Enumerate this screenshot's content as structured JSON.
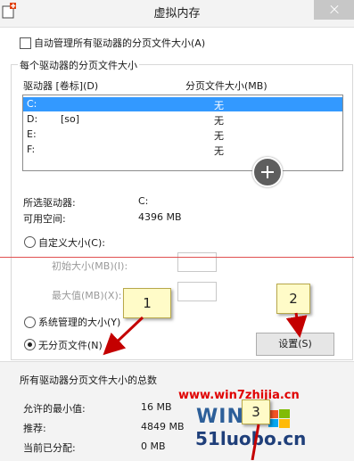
{
  "window": {
    "title": "虚拟内存"
  },
  "auto_manage": {
    "label": "自动管理所有驱动器的分页文件大小(A)"
  },
  "per_drive": {
    "group_title": "每个驱动器的分页文件大小",
    "col_drive": "驱动器 [卷标](D)",
    "col_size": "分页文件大小(MB)",
    "rows": [
      {
        "drive": "C:",
        "label": "",
        "size": "无"
      },
      {
        "drive": "D:",
        "label": "[so]",
        "size": "无"
      },
      {
        "drive": "E:",
        "label": "",
        "size": "无"
      },
      {
        "drive": "F:",
        "label": "",
        "size": "无"
      }
    ]
  },
  "selected_drive": {
    "label": "所选驱动器:",
    "value": "C:"
  },
  "free_space": {
    "label": "可用空间:",
    "value": "4396 MB"
  },
  "custom_size": {
    "label": "自定义大小(C):"
  },
  "initial_size": {
    "label": "初始大小(MB)(I):"
  },
  "max_size": {
    "label": "最大值(MB)(X):"
  },
  "system_managed": {
    "label": "系统管理的大小(Y)"
  },
  "no_paging": {
    "label": "无分页文件(N)"
  },
  "set_button": {
    "label": "设置(S)"
  },
  "callouts": {
    "one": "1",
    "two": "2",
    "three": "3"
  },
  "totals": {
    "group_title": "所有驱动器分页文件大小的总数",
    "min_allowed": {
      "label": "允许的最小值:",
      "value": "16 MB"
    },
    "recommended": {
      "label": "推荐:",
      "value": "4849 MB"
    },
    "current": {
      "label": "当前已分配:",
      "value": "0 MB"
    }
  },
  "watermark": {
    "url": "www.win7zhijia.cn",
    "logo": "WIN7",
    "site": "51luobo.cn"
  },
  "colors": {
    "selection": "#3399ff",
    "callout": "#fffbc8",
    "arrow": "#c40000",
    "watermark_red": "#e00000"
  }
}
